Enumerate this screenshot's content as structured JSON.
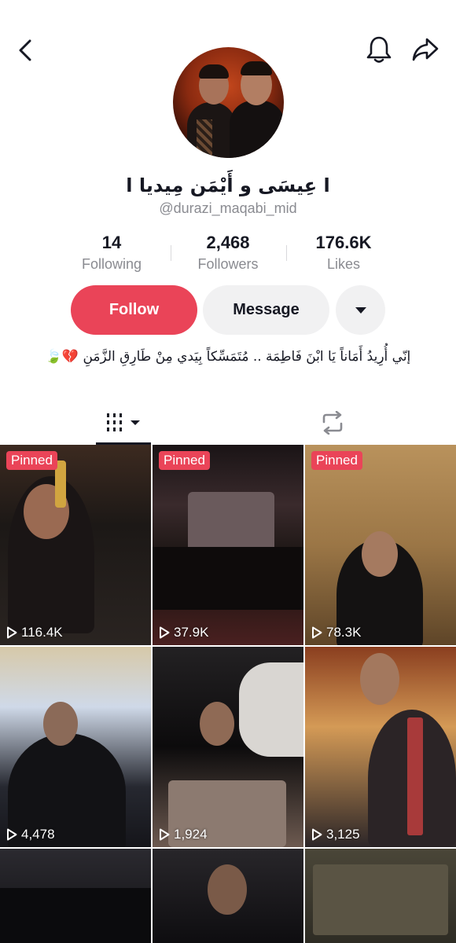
{
  "profile": {
    "display_name": "ا عِيسَى و أَيْمَن مِيديا ا",
    "username": "@durazi_maqabi_mid",
    "bio": "إنّي أُرِيدُ أَمَاناً يَا ابْنَ فَاطِمَة .. مُتَمَسِّكاً بِيَدي مِنْ طَارِقِ الزَّمَنِ 💔🍃"
  },
  "stats": {
    "following": {
      "value": "14",
      "label": "Following"
    },
    "followers": {
      "value": "2,468",
      "label": "Followers"
    },
    "likes": {
      "value": "176.6K",
      "label": "Likes"
    }
  },
  "actions": {
    "follow_label": "Follow",
    "message_label": "Message"
  },
  "tabs": {
    "videos_icon": "grid-icon",
    "reposts_icon": "repost-icon"
  },
  "videos": [
    {
      "pinned": "Pinned",
      "views": "116.4K"
    },
    {
      "pinned": "Pinned",
      "views": "37.9K"
    },
    {
      "pinned": "Pinned",
      "views": "78.3K"
    },
    {
      "pinned": "",
      "views": "4,478"
    },
    {
      "pinned": "",
      "views": "1,924"
    },
    {
      "pinned": "",
      "views": "3,125"
    },
    {
      "pinned": "",
      "views": ""
    },
    {
      "pinned": "",
      "views": ""
    },
    {
      "pinned": "",
      "views": ""
    }
  ],
  "colors": {
    "accent": "#ea4458",
    "secondary_button": "#f1f1f2",
    "muted_text": "#8a8b91"
  }
}
